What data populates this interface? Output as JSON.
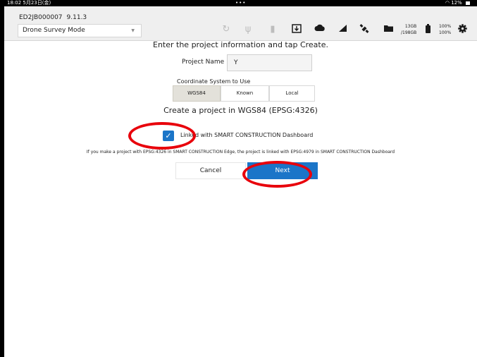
{
  "status_bar": {
    "time": "18:02  5月23日(金)",
    "dots": "•••",
    "battery": "12%"
  },
  "header": {
    "device_id": "ED2JB000007",
    "version": "9.11.3",
    "mode_select_value": "Drone Survey Mode",
    "storage_used": "13GB",
    "storage_total": "/198GB",
    "battery_level_1": "100%",
    "battery_level_2": "100%",
    "icons": [
      "refresh-icon",
      "usb-icon",
      "sd-card-icon",
      "download-icon",
      "cloud-icon",
      "signal-icon",
      "satellite-icon",
      "folder-icon",
      "battery-icon",
      "gear-icon"
    ]
  },
  "form": {
    "instruction": "Enter the project information and tap Create.",
    "project_name_label": "Project Name",
    "project_name_value": "Y",
    "coordinate_system_label": "Coordinate System to Use",
    "coordinate_options": [
      "WGS84",
      "Known",
      "Local"
    ],
    "coordinate_selected": "WGS84",
    "create_title": "Create a project in WGS84 (EPSG:4326)",
    "link_checkbox_checked": true,
    "link_checkbox_label": "Linked with SMART CONSTRUCTION Dashboard",
    "note": "If you make a project with EPSG:4326 in SMART CONSTRUCTION Edge, the project is linked with EPSG:4979 in SMART CONSTRUCTION Dashboard",
    "cancel_label": "Cancel",
    "next_label": "Next"
  },
  "colors": {
    "accent": "#1b75c8",
    "annotation": "#e8000b",
    "selected_segment": "#e3e1da"
  }
}
